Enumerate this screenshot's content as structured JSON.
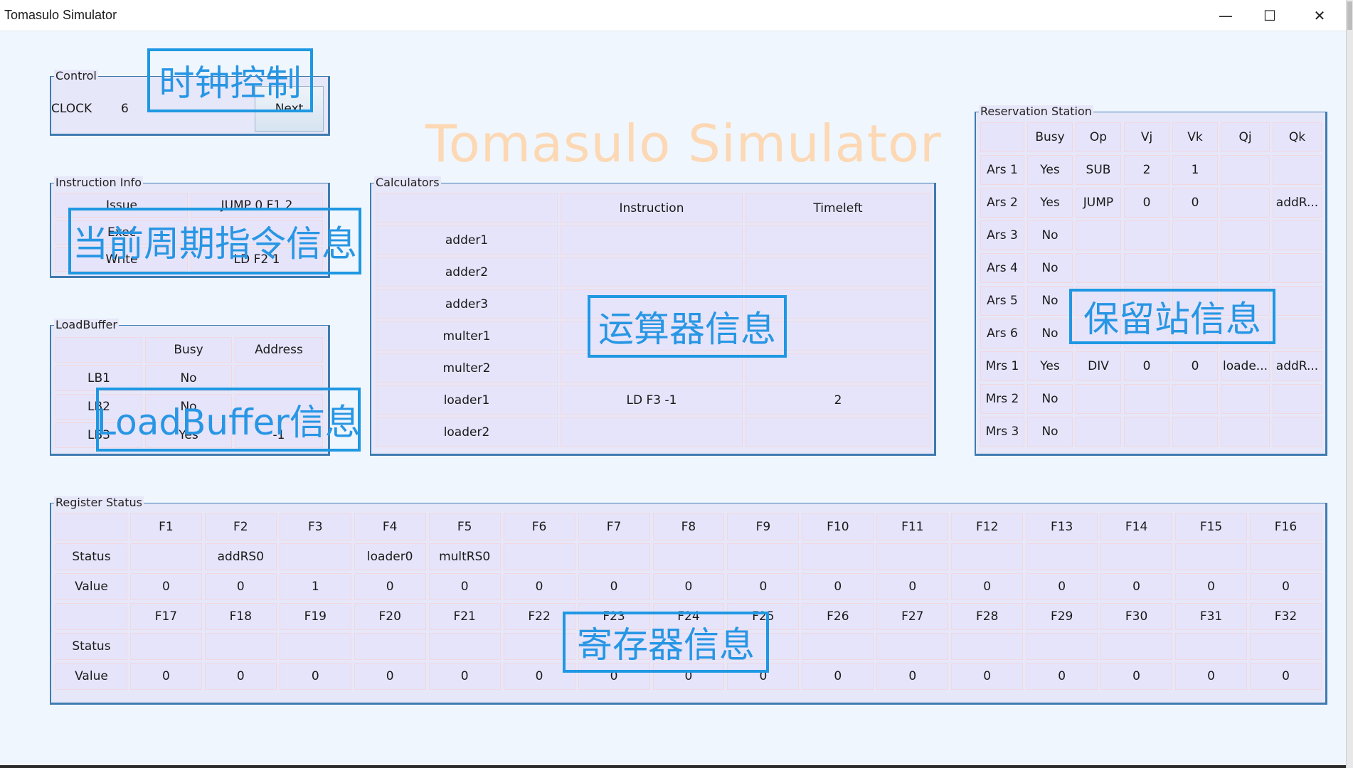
{
  "window": {
    "title": "Tomasulo Simulator",
    "minimize": "—",
    "maximize": "☐",
    "close": "✕"
  },
  "brand_title": "Tomasulo Simulator",
  "control": {
    "caption": "Control",
    "clock_label": "CLOCK",
    "clock_value": "6",
    "next_label": "Next"
  },
  "instruction_info": {
    "caption": "Instruction Info",
    "rows": [
      {
        "stage": "Issue",
        "instr": "JUMP 0 F1 2"
      },
      {
        "stage": "Exec",
        "instr": ""
      },
      {
        "stage": "Write",
        "instr": "LD F2 1"
      }
    ]
  },
  "load_buffer": {
    "caption": "LoadBuffer",
    "headers": [
      "",
      "Busy",
      "Address"
    ],
    "rows": [
      [
        "LB1",
        "No",
        ""
      ],
      [
        "LB2",
        "No",
        ""
      ],
      [
        "LB3",
        "Yes",
        "-1"
      ]
    ]
  },
  "calculators": {
    "caption": "Calculators",
    "headers": [
      "",
      "Instruction",
      "Timeleft"
    ],
    "rows": [
      [
        "adder1",
        "",
        ""
      ],
      [
        "adder2",
        "",
        ""
      ],
      [
        "adder3",
        "",
        ""
      ],
      [
        "multer1",
        "",
        ""
      ],
      [
        "multer2",
        "",
        ""
      ],
      [
        "loader1",
        "LD F3 -1",
        "2"
      ],
      [
        "loader2",
        "",
        ""
      ]
    ]
  },
  "reservation_station": {
    "caption": "Reservation Station",
    "headers": [
      "",
      "Busy",
      "Op",
      "Vj",
      "Vk",
      "Qj",
      "Qk"
    ],
    "rows": [
      [
        "Ars 1",
        "Yes",
        "SUB",
        "2",
        "1",
        "",
        ""
      ],
      [
        "Ars 2",
        "Yes",
        "JUMP",
        "0",
        "0",
        "",
        "addR..."
      ],
      [
        "Ars 3",
        "No",
        "",
        "",
        "",
        "",
        ""
      ],
      [
        "Ars 4",
        "No",
        "",
        "",
        "",
        "",
        ""
      ],
      [
        "Ars 5",
        "No",
        "",
        "",
        "",
        "",
        ""
      ],
      [
        "Ars 6",
        "No",
        "",
        "",
        "",
        "",
        ""
      ],
      [
        "Mrs 1",
        "Yes",
        "DIV",
        "0",
        "0",
        "loade...",
        "addR..."
      ],
      [
        "Mrs 2",
        "No",
        "",
        "",
        "",
        "",
        ""
      ],
      [
        "Mrs 3",
        "No",
        "",
        "",
        "",
        "",
        ""
      ]
    ]
  },
  "register_status": {
    "caption": "Register Status",
    "rows": [
      [
        "",
        "F1",
        "F2",
        "F3",
        "F4",
        "F5",
        "F6",
        "F7",
        "F8",
        "F9",
        "F10",
        "F11",
        "F12",
        "F13",
        "F14",
        "F15",
        "F16"
      ],
      [
        "Status",
        "",
        "addRS0",
        "",
        "loader0",
        "multRS0",
        "",
        "",
        "",
        "",
        "",
        "",
        "",
        "",
        "",
        "",
        ""
      ],
      [
        "Value",
        "0",
        "0",
        "1",
        "0",
        "0",
        "0",
        "0",
        "0",
        "0",
        "0",
        "0",
        "0",
        "0",
        "0",
        "0",
        "0"
      ],
      [
        "",
        "F17",
        "F18",
        "F19",
        "F20",
        "F21",
        "F22",
        "F23",
        "F24",
        "F25",
        "F26",
        "F27",
        "F28",
        "F29",
        "F30",
        "F31",
        "F32"
      ],
      [
        "Status",
        "",
        "",
        "",
        "",
        "",
        "",
        "",
        "",
        "",
        "",
        "",
        "",
        "",
        "",
        "",
        ""
      ],
      [
        "Value",
        "0",
        "0",
        "0",
        "0",
        "0",
        "0",
        "0",
        "0",
        "0",
        "0",
        "0",
        "0",
        "0",
        "0",
        "0",
        "0"
      ]
    ]
  },
  "annotations": {
    "clock": "时钟控制",
    "instruction": "当前周期指令信息",
    "loadbuffer": "LoadBuffer信息",
    "calculators": "运算器信息",
    "reservation": "保留站信息",
    "register": "寄存器信息"
  },
  "colors": {
    "panel_bg": "#e7e7fa",
    "panel_border": "#3f7bb0",
    "annotation": "#1e98e3",
    "brand": "#fcd8b4",
    "page_bg": "#f0f6fd"
  }
}
